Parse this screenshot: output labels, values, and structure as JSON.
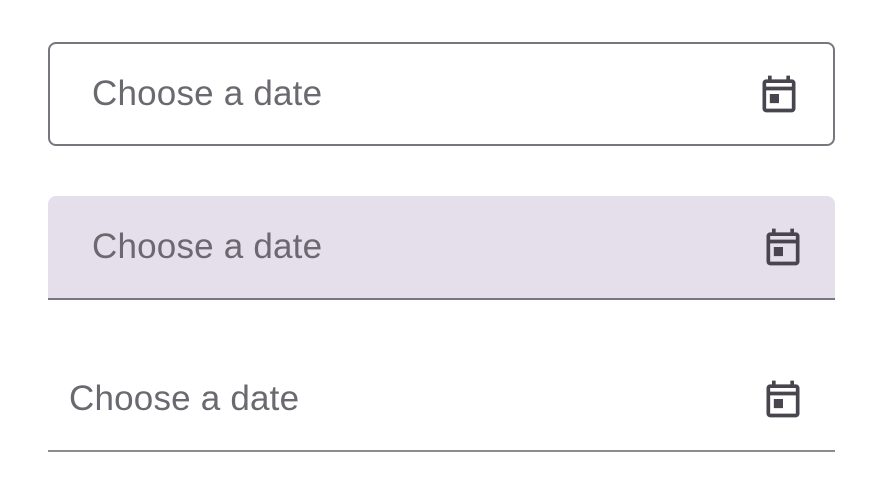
{
  "fields": [
    {
      "appearance": "outline",
      "placeholder": "Choose a date",
      "icon": "calendar-icon"
    },
    {
      "appearance": "fill",
      "placeholder": "Choose a date",
      "icon": "calendar-icon"
    },
    {
      "appearance": "legacy",
      "placeholder": "Choose a date",
      "icon": "calendar-icon"
    }
  ],
  "colors": {
    "label_text": "#6b6870",
    "outline_border": "#79767d",
    "fill_background": "#e5dfeb",
    "icon": "#49454f"
  }
}
